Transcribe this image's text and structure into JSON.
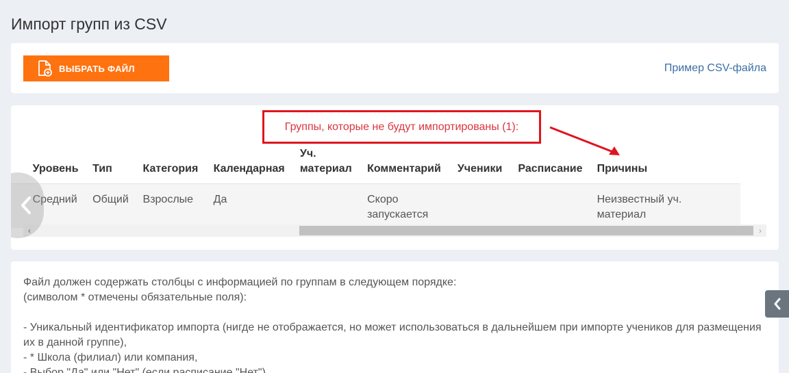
{
  "page": {
    "title": "Импорт групп из CSV"
  },
  "upload": {
    "choose_button_label": "ВЫБРАТЬ ФАЙЛ",
    "example_link": "Пример CSV-файла",
    "accent_color": "#ff7210"
  },
  "not_imported": {
    "heading": "Группы, которые не будут импортированы (1):",
    "columns": [
      "",
      "Уровень",
      "Тип",
      "Категория",
      "Календарная",
      "Уч. материал",
      "Комментарий",
      "Ученики",
      "Расписание",
      "Причины"
    ],
    "rows": [
      {
        "first": "ий",
        "level": "Средний",
        "type": "Общий",
        "category": "Взрослые",
        "calendar": "Да",
        "material": "",
        "comment": "Скоро запускается",
        "students": "",
        "schedule": "",
        "reasons": "Неизвестный уч. материал"
      }
    ]
  },
  "info": {
    "lines": [
      "Файл должен содержать столбцы с информацией по группам в следующем порядке:",
      "(символом * отмечены обязательные поля):",
      "",
      "- Уникальный идентификатор импорта (нигде не отображается, но может использоваться в дальнейшем при импорте учеников для размещения их в данной группе),",
      "- * Школа (филиал) или компания,",
      "- Выбор \"Да\" или \"Нет\" (если расписание \"Нет\")"
    ]
  },
  "icons": {
    "file_add": "file-add-icon",
    "carousel_prev": "chevron-left-icon",
    "side_toggle": "chevron-left-icon",
    "annotation_arrow": "red-arrow"
  }
}
